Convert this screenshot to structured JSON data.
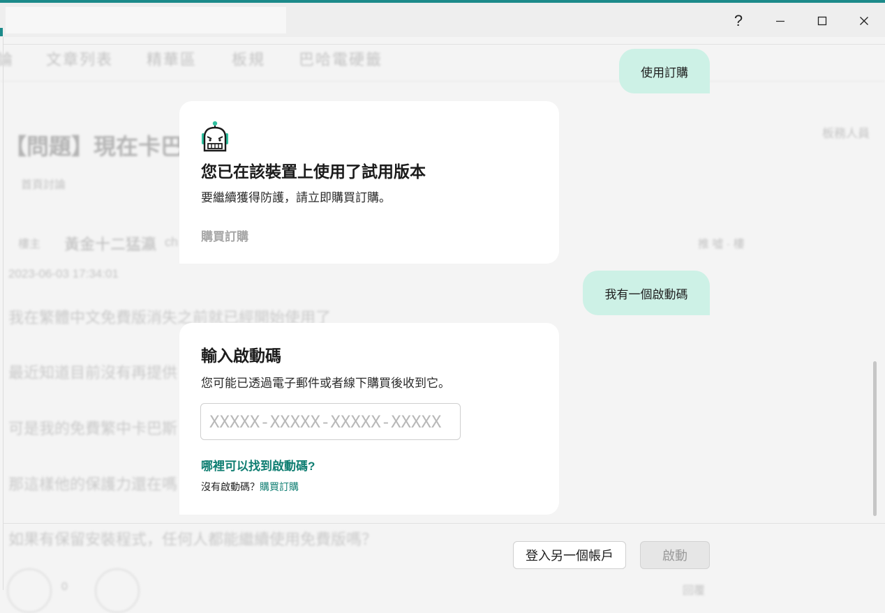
{
  "window": {
    "help_glyph": "?",
    "minimize_glyph": "—",
    "close_glyph": "✕"
  },
  "background": {
    "nav": [
      "論",
      "文章列表",
      "精華區",
      "板規",
      "巴哈電硬籤"
    ],
    "thread_title": "【問題】現在卡巴",
    "small_label": "首頁討論",
    "floor_label": "樓主",
    "author": "黃金十二猛瀛",
    "author_suffix": "ch",
    "post_time": "2023-06-03 17:34:01",
    "right_label": "板務人員",
    "right_meta": "推 噓 · 樓",
    "body_lines": [
      "我在繁體中文免費版消失之前就已經開始使用了",
      "最近知道目前沒有再提供",
      "可是我的免費繁中卡巴斯",
      "那這樣他的保護力還在嗎",
      "如果有保留安裝程式，任何人都能繼續使用免費版嗎？"
    ],
    "stat_1": "0",
    "stat_2": "回覆"
  },
  "chat": {
    "user_message_1": "使用訂購",
    "user_message_2": "我有一個啟動碼"
  },
  "trial_card": {
    "icon": "robot-icon",
    "title": "您已在該裝置上使用了試用版本",
    "subtitle": "要繼續獲得防護，請立即購買訂購。",
    "buy_label": "購買訂購"
  },
  "activation_card": {
    "title": "輸入啟動碼",
    "subtitle": "您可能已透過電子郵件或者線下購買後收到它。",
    "input_placeholder": "XXXXX-XXXXX-XXXXX-XXXXX",
    "input_value": "",
    "where_link": "哪裡可以找到啟動碼?",
    "no_code_prefix": "沒有啟動碼？",
    "no_code_link": "購買訂購"
  },
  "footer": {
    "sign_in_other": "登入另一個帳戶",
    "activate": "啟動"
  },
  "colors": {
    "accent": "#1c8a8a",
    "bubble": "#cdf1e6",
    "link": "#0f7e72"
  }
}
